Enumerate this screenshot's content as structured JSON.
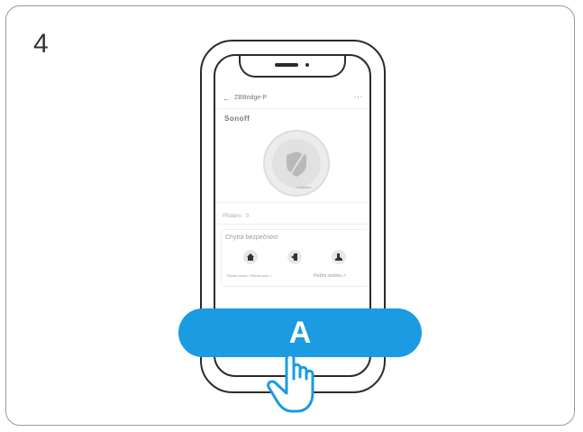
{
  "step_number": "4",
  "app": {
    "back_glyph": "←",
    "device_title": "ZBBridge-P",
    "more_glyph": "···",
    "brand_logo": "SONOFF",
    "arm_status": "Odjištěno",
    "added_count_label": "Přidáno : 0",
    "smart_security_title": "Chytrá bezpečnost",
    "modes": [
      {
        "icon": "home-icon",
        "label": "Režim doma"
      },
      {
        "icon": "away-icon",
        "label": "Režim pryč"
      },
      {
        "icon": "sleep-icon",
        "label": "Režim spánku"
      }
    ],
    "mode_label_home_away": "Režim doma \\ Režim pryč >",
    "mode_label_sleep": "Režim spánku >"
  },
  "action_button": {
    "label": "A",
    "color": "#1a9be2"
  },
  "icons": [
    "shield-icon",
    "home-icon",
    "away-icon",
    "sleep-icon",
    "pointing-hand-icon"
  ]
}
